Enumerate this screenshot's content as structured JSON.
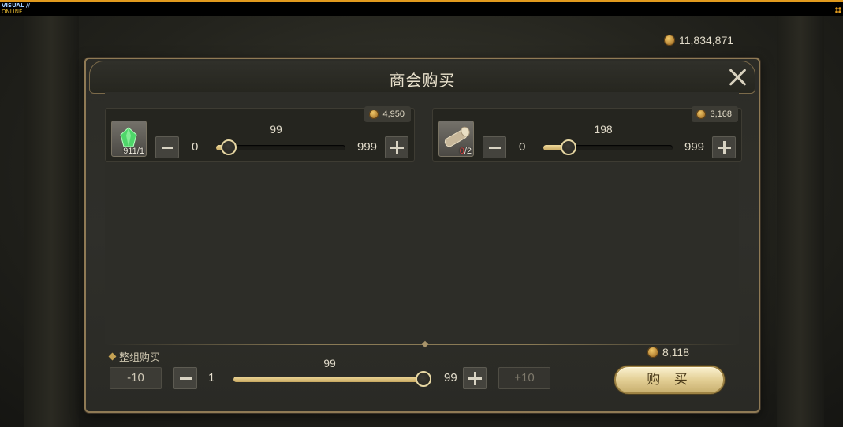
{
  "overlay": {
    "brand_line1": "VISUAL //",
    "brand_line2": "ONLINE"
  },
  "currency": {
    "total": "11,834,871"
  },
  "dialog": {
    "title": "商会购买",
    "items": [
      {
        "icon": "green-crystal-icon",
        "price": "4,950",
        "owned": "911",
        "need": "/1",
        "min": "0",
        "max": "999",
        "current": "99",
        "fraction": 0.1
      },
      {
        "icon": "log-icon",
        "price": "3,168",
        "owned": "0",
        "need": "/2",
        "min": "0",
        "max": "999",
        "current": "198",
        "fraction": 0.2
      }
    ],
    "bulk": {
      "label": "整组购买",
      "minus10": "-10",
      "min": "1",
      "max": "99",
      "current": "99",
      "plus10": "+10",
      "fraction": 1.0
    },
    "total_price": "8,118",
    "buy_label": "购 买"
  },
  "colors": {
    "accent_gold": "#e7d7a3",
    "panel_border": "#8f7a55",
    "topbar_accent": "#e09a1e"
  }
}
